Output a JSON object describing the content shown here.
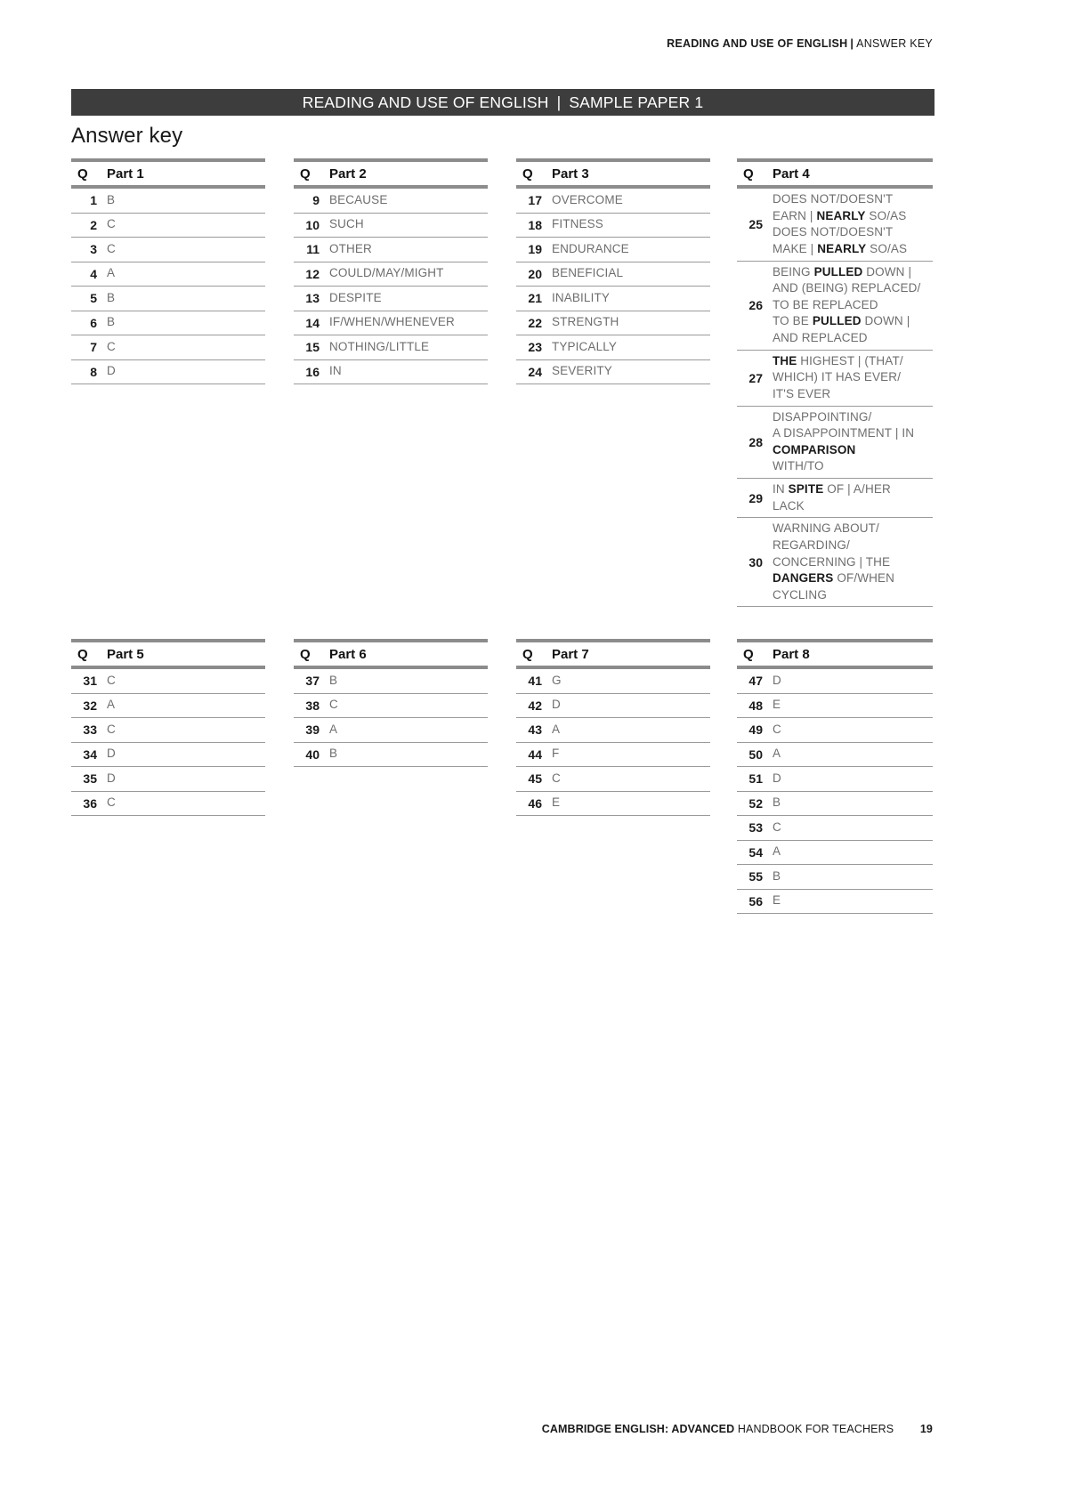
{
  "running_head": {
    "left": "READING AND USE OF ENGLISH",
    "separator": "|",
    "right": "ANSWER KEY"
  },
  "banner": {
    "left": "READING AND USE OF ENGLISH",
    "separator": "|",
    "right": "SAMPLE PAPER 1"
  },
  "page_title": "Answer key",
  "column_headers": {
    "q": "Q"
  },
  "tables": [
    {
      "id": "part1",
      "title": "Part 1",
      "rows": [
        {
          "q": "1",
          "a": "B"
        },
        {
          "q": "2",
          "a": "C"
        },
        {
          "q": "3",
          "a": "C"
        },
        {
          "q": "4",
          "a": "A"
        },
        {
          "q": "5",
          "a": "B"
        },
        {
          "q": "6",
          "a": "B"
        },
        {
          "q": "7",
          "a": "C"
        },
        {
          "q": "8",
          "a": "D"
        }
      ]
    },
    {
      "id": "part2",
      "title": "Part 2",
      "rows": [
        {
          "q": "9",
          "a": "BECAUSE"
        },
        {
          "q": "10",
          "a": "SUCH"
        },
        {
          "q": "11",
          "a": "OTHER"
        },
        {
          "q": "12",
          "a": "COULD/MAY/MIGHT"
        },
        {
          "q": "13",
          "a": "DESPITE"
        },
        {
          "q": "14",
          "a": "IF/WHEN/WHENEVER"
        },
        {
          "q": "15",
          "a": "NOTHING/LITTLE"
        },
        {
          "q": "16",
          "a": "IN"
        }
      ]
    },
    {
      "id": "part3",
      "title": "Part 3",
      "rows": [
        {
          "q": "17",
          "a": "OVERCOME"
        },
        {
          "q": "18",
          "a": "FITNESS"
        },
        {
          "q": "19",
          "a": "ENDURANCE"
        },
        {
          "q": "20",
          "a": "BENEFICIAL"
        },
        {
          "q": "21",
          "a": "INABILITY"
        },
        {
          "q": "22",
          "a": "STRENGTH"
        },
        {
          "q": "23",
          "a": "TYPICALLY"
        },
        {
          "q": "24",
          "a": "SEVERITY"
        }
      ]
    },
    {
      "id": "part4",
      "title": "Part 4",
      "rows": [
        {
          "q": "25",
          "a_html": "DOES NOT/DOESN'T<br>EARN | <b>NEARLY</b> SO/AS<br>DOES NOT/DOESN'T<br>MAKE | <b>NEARLY</b> SO/AS"
        },
        {
          "q": "26",
          "a_html": "BEING <b>PULLED</b> DOWN |<br>AND (BEING) REPLACED/<br>TO BE REPLACED<br>TO BE <b>PULLED</b> DOWN |<br>AND REPLACED"
        },
        {
          "q": "27",
          "a_html": "<b>THE</b> HIGHEST | (THAT/<br>WHICH) IT HAS EVER/<br>IT'S EVER"
        },
        {
          "q": "28",
          "a_html": "DISAPPOINTING/<br>A DISAPPOINTMENT | IN<br><b>COMPARISON</b><br>WITH/TO"
        },
        {
          "q": "29",
          "a_html": "IN <b>SPITE</b> OF | A/HER<br>LACK"
        },
        {
          "q": "30",
          "a_html": "WARNING ABOUT/<br>REGARDING/<br>CONCERNING | THE<br><b>DANGERS</b> OF/WHEN<br>CYCLING"
        }
      ]
    },
    {
      "id": "part5",
      "title": "Part 5",
      "rows": [
        {
          "q": "31",
          "a": "C"
        },
        {
          "q": "32",
          "a": "A"
        },
        {
          "q": "33",
          "a": "C"
        },
        {
          "q": "34",
          "a": "D"
        },
        {
          "q": "35",
          "a": "D"
        },
        {
          "q": "36",
          "a": "C"
        }
      ]
    },
    {
      "id": "part6",
      "title": "Part 6",
      "rows": [
        {
          "q": "37",
          "a": "B"
        },
        {
          "q": "38",
          "a": "C"
        },
        {
          "q": "39",
          "a": "A"
        },
        {
          "q": "40",
          "a": "B"
        }
      ]
    },
    {
      "id": "part7",
      "title": "Part 7",
      "rows": [
        {
          "q": "41",
          "a": "G"
        },
        {
          "q": "42",
          "a": "D"
        },
        {
          "q": "43",
          "a": "A"
        },
        {
          "q": "44",
          "a": "F"
        },
        {
          "q": "45",
          "a": "C"
        },
        {
          "q": "46",
          "a": "E"
        }
      ]
    },
    {
      "id": "part8",
      "title": "Part 8",
      "rows": [
        {
          "q": "47",
          "a": "D"
        },
        {
          "q": "48",
          "a": "E"
        },
        {
          "q": "49",
          "a": "C"
        },
        {
          "q": "50",
          "a": "A"
        },
        {
          "q": "51",
          "a": "D"
        },
        {
          "q": "52",
          "a": "B"
        },
        {
          "q": "53",
          "a": "C"
        },
        {
          "q": "54",
          "a": "A"
        },
        {
          "q": "55",
          "a": "B"
        },
        {
          "q": "56",
          "a": "E"
        }
      ]
    }
  ],
  "footer": {
    "strong": "CAMBRIDGE ENGLISH: ADVANCED",
    "light": "HANDBOOK FOR TEACHERS",
    "page_number": "19"
  },
  "colors": {
    "banner_bg": "#3d3d3d",
    "rule": "#8c8c8c",
    "row_rule": "#9a9a9a",
    "answer_text": "#6e6e6e",
    "heading_text": "#111111"
  }
}
